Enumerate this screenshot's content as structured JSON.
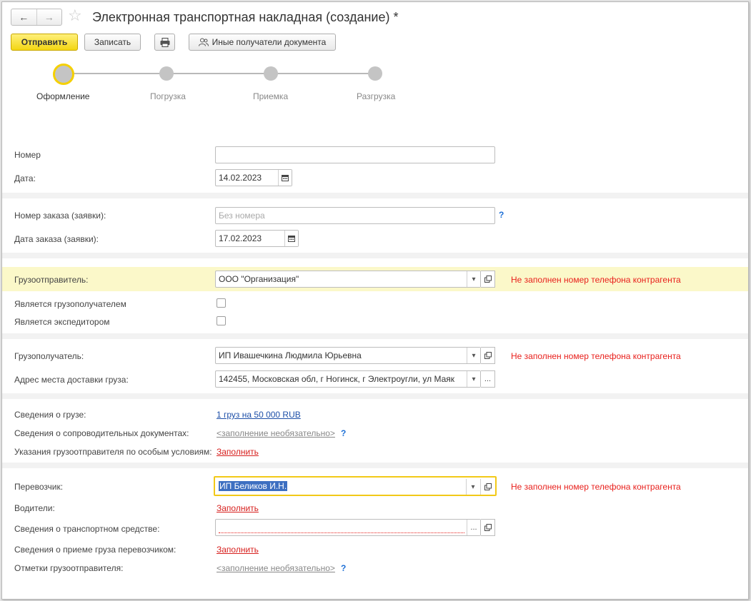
{
  "header": {
    "back_icon": "arrow-left-icon",
    "forward_icon": "arrow-right-icon",
    "favorite_icon": "star-icon",
    "title": "Электронная транспортная накладная (создание) *"
  },
  "toolbar": {
    "send_label": "Отправить",
    "save_label": "Записать",
    "print_icon": "printer-icon",
    "other_recipients_label": "Иные получатели документа"
  },
  "steps": [
    {
      "label": "Оформление",
      "active": true
    },
    {
      "label": "Погрузка",
      "active": false
    },
    {
      "label": "Приемка",
      "active": false
    },
    {
      "label": "Разгрузка",
      "active": false
    }
  ],
  "form": {
    "number": {
      "label": "Номер",
      "value": ""
    },
    "date": {
      "label": "Дата:",
      "value": "14.02.2023"
    },
    "order_number": {
      "label": "Номер заказа (заявки):",
      "placeholder": "Без номера",
      "help": "?"
    },
    "order_date": {
      "label": "Дата заказа (заявки):",
      "value": "17.02.2023"
    },
    "shipper": {
      "label": "Грузоотправитель:",
      "value": "ООО \"Организация\"",
      "warning": "Не заполнен номер телефона контрагента"
    },
    "is_consignee": {
      "label": "Является грузополучателем",
      "checked": false
    },
    "is_forwarder": {
      "label": "Является экспедитором",
      "checked": false
    },
    "consignee": {
      "label": "Грузополучатель:",
      "value": "ИП Ивашечкина Людмила Юрьевна",
      "warning": "Не заполнен номер телефона контрагента"
    },
    "delivery_address": {
      "label": "Адрес места доставки груза:",
      "value": "142455, Московская обл, г Ногинск, г Электроугли, ул Маяк"
    },
    "cargo_info": {
      "label": "Сведения о грузе:",
      "link": "1 груз на 50 000 RUB"
    },
    "accompanying_docs": {
      "label": "Сведения о сопроводительных документах:",
      "link": "<заполнение необязательно>",
      "help": "?"
    },
    "special_conditions": {
      "label": "Указания грузоотправителя по особым условиям:",
      "link": "Заполнить"
    },
    "carrier": {
      "label": "Перевозчик:",
      "value": "ИП Беликов И.Н.",
      "warning": "Не заполнен номер телефона контрагента"
    },
    "drivers": {
      "label": "Водители:",
      "link": "Заполнить"
    },
    "vehicle": {
      "label": "Сведения о транспортном средстве:",
      "value": ""
    },
    "carrier_acceptance": {
      "label": "Сведения о приеме груза перевозчиком:",
      "link": "Заполнить"
    },
    "shipper_marks": {
      "label": "Отметки грузоотправителя:",
      "link": "<заполнение необязательно>",
      "help": "?"
    }
  },
  "colors": {
    "primary_button": "#f3d613",
    "warning_text": "#e8201c",
    "highlight_row": "#fbf8c9",
    "link_blue": "#1d4fa8",
    "link_red": "#d7201e"
  }
}
